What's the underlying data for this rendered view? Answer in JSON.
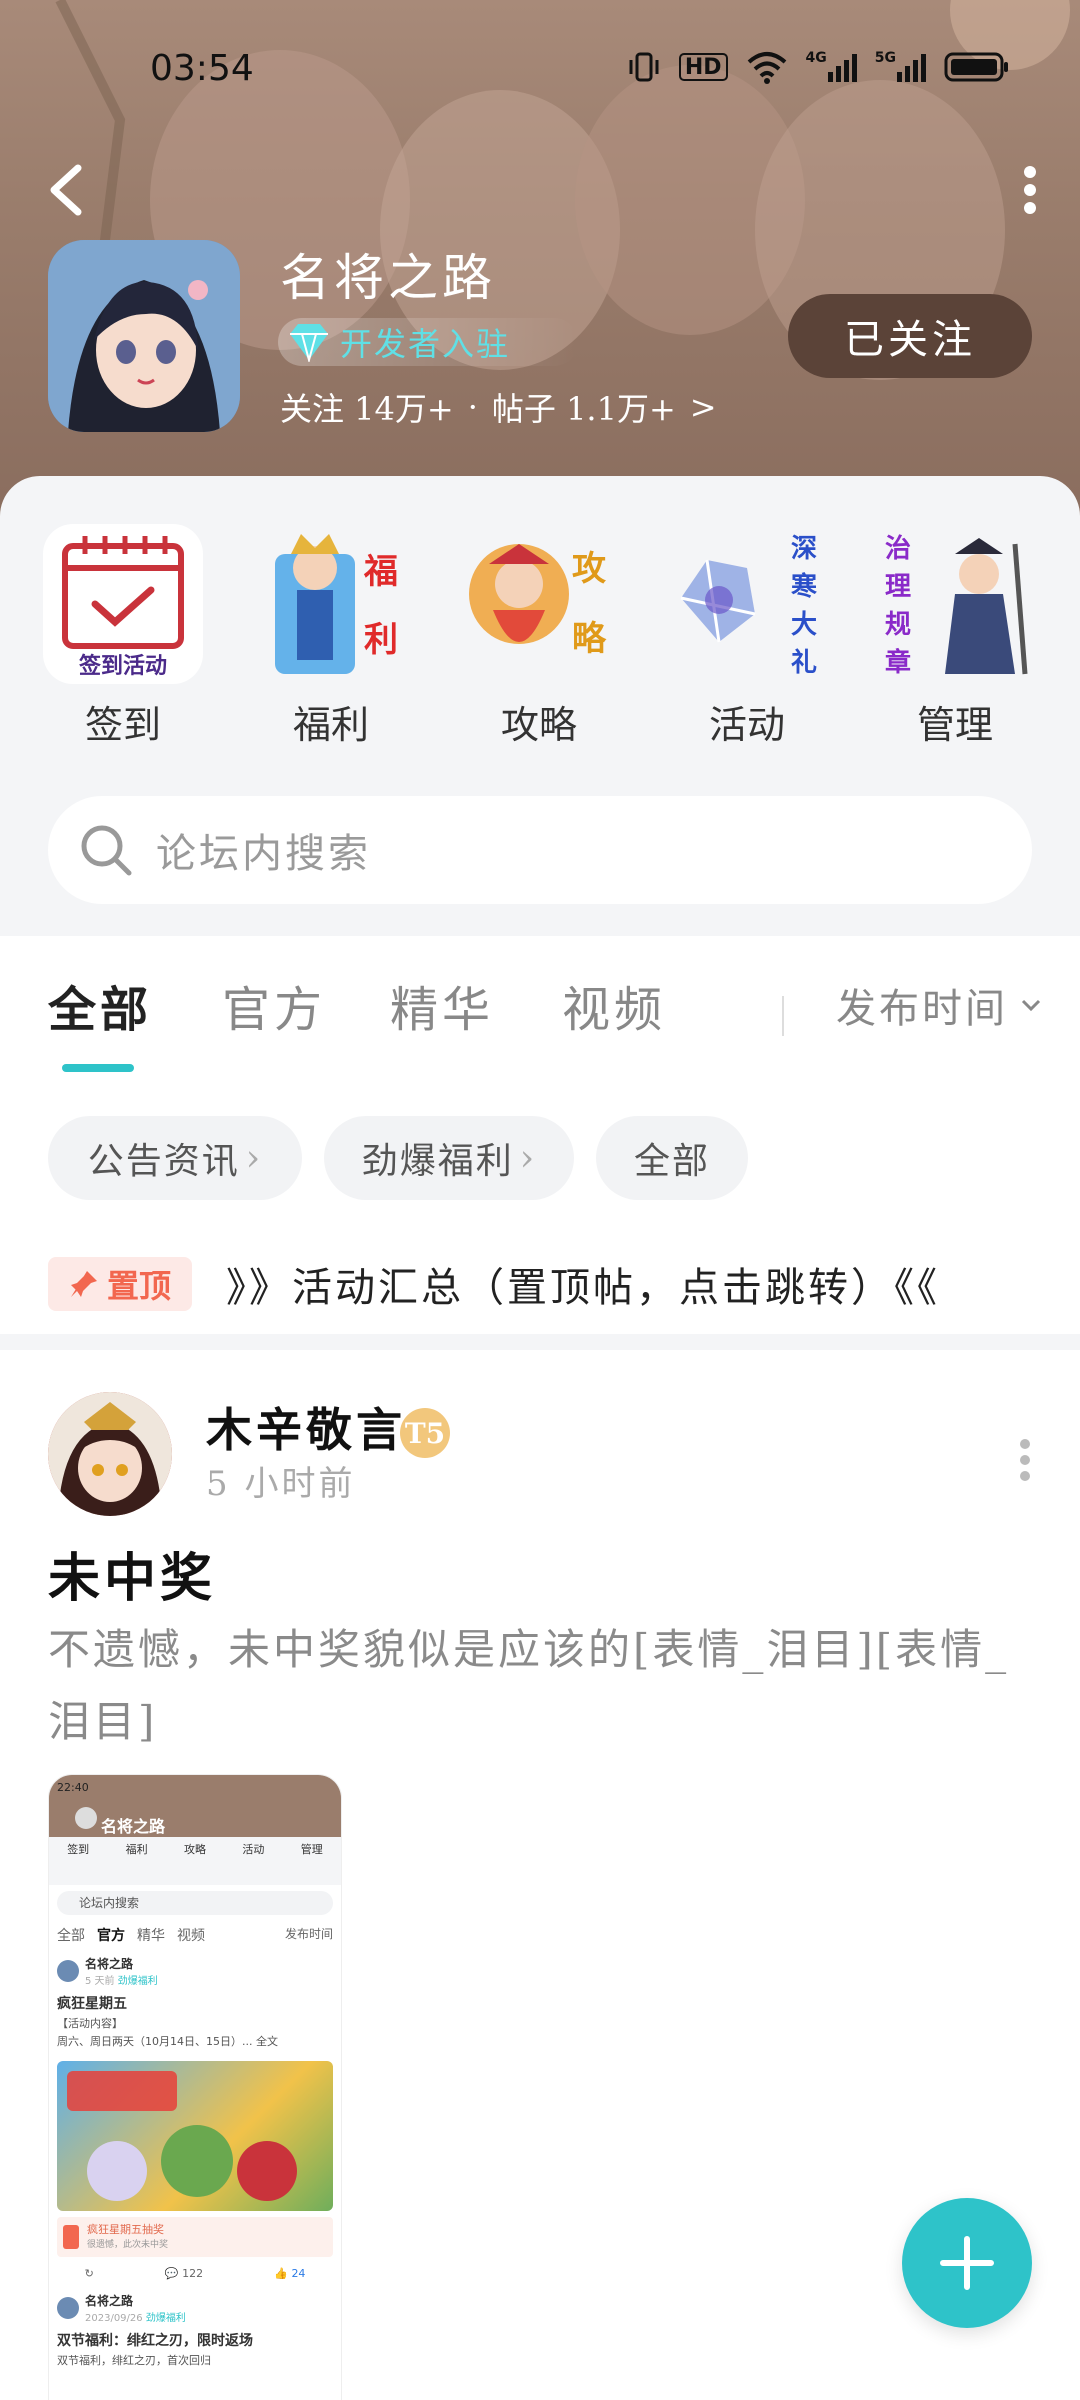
{
  "status_bar": {
    "time": "03:54",
    "hd_label": "HD",
    "net1": "4G",
    "net2": "5G"
  },
  "header": {
    "game_title": "名将之路",
    "developer_badge": "开发者入驻",
    "followers": "关注 14万+",
    "dot": "·",
    "posts": "帖子 1.1万+",
    "posts_arrow": ">",
    "follow_button": "已关注",
    "icon_names": [
      "back-arrow-icon",
      "more-vertical-icon",
      "diamond-icon"
    ]
  },
  "quick_links": [
    {
      "label": "签到",
      "icon_text": "签到活动"
    },
    {
      "label": "福利",
      "icon_text": "福利"
    },
    {
      "label": "攻略",
      "icon_text": "攻略"
    },
    {
      "label": "活动",
      "icon_text": "深寒大礼"
    },
    {
      "label": "管理",
      "icon_text": "治理规章"
    }
  ],
  "search": {
    "placeholder": "论坛内搜索"
  },
  "tabs": {
    "items": [
      "全部",
      "官方",
      "精华",
      "视频"
    ],
    "active": "全部",
    "sort_label": "发布时间"
  },
  "chips": [
    {
      "label": "公告资讯",
      "arrow": "›"
    },
    {
      "label": "劲爆福利",
      "arrow": "›"
    },
    {
      "label": "全部",
      "arrow": ""
    }
  ],
  "pinned": {
    "tag": "置顶",
    "text": "》》活动汇总（置顶帖，点击跳转）《《"
  },
  "post": {
    "author": "木辛敬言",
    "level": "T5",
    "time": "5 小时前",
    "title": "未中奖",
    "body": "不遗憾，未中奖貌似是应该的[表情_泪目][表情_泪目]",
    "thumbnail": {
      "time": "22:40",
      "title": "名将之路",
      "quick": [
        "签到",
        "福利",
        "攻略",
        "活动",
        "管理"
      ],
      "search": "论坛内搜索",
      "tabs": [
        "全部",
        "官方",
        "精华",
        "视频"
      ],
      "sort": "发布时间",
      "post1_name": "名将之路",
      "post1_meta": "5 天前",
      "post1_tag": "劲爆福利",
      "post1_title": "疯狂星期五",
      "post1_line1": "【活动内容】",
      "post1_line2": "周六、周日两天（10月14日、15日）... 全文",
      "lottery_title": "疯狂星期五抽奖",
      "lottery_sub": "很遗憾，此次未中奖",
      "comments": "122",
      "likes": "24",
      "post2_name": "名将之路",
      "post2_meta": "2023/09/26",
      "post2_tag": "劲爆福利",
      "post2_title": "双节福利：绯红之刃，限时返场",
      "post2_line": "双节福利，绯红之刃，首次回归"
    }
  },
  "fab": {
    "icon": "plus-icon"
  },
  "colors": {
    "accent": "#2ec3c9",
    "header_bg": "#9a7d6c",
    "follow_btn": "#5b4338",
    "pin_red": "#f2674f"
  }
}
